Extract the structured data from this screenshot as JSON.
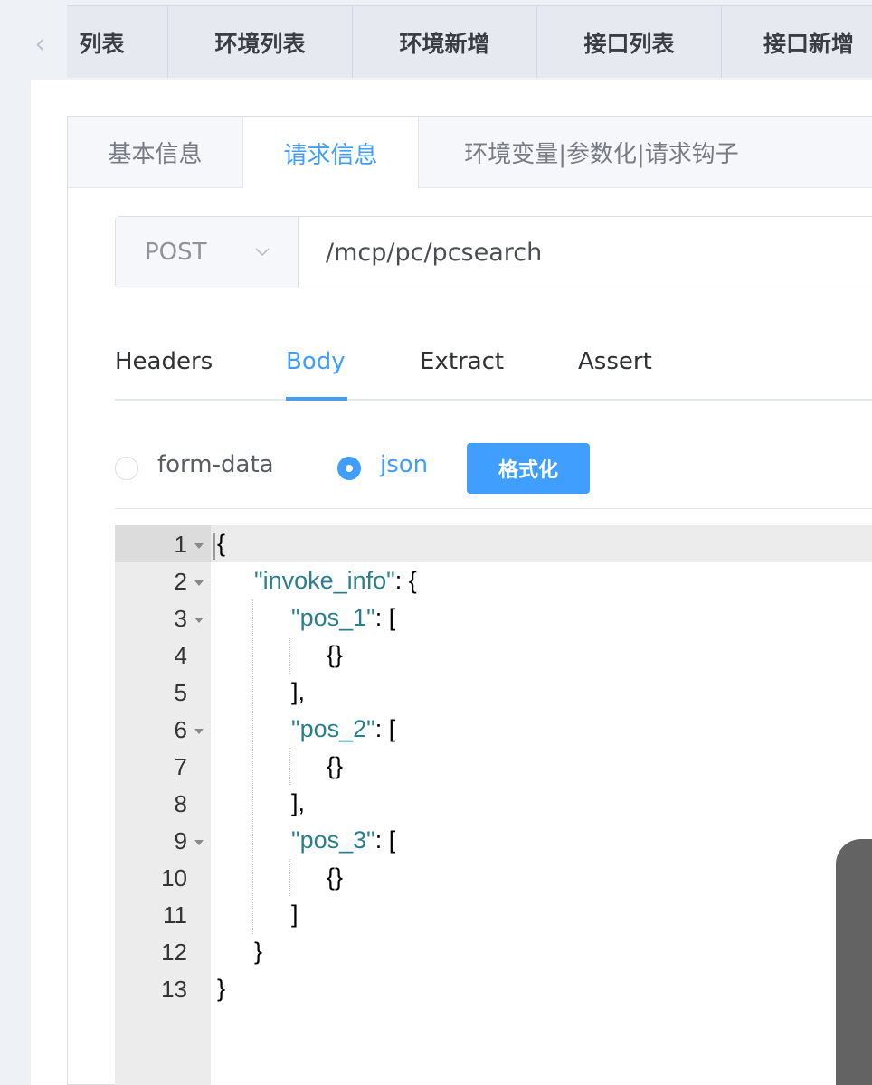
{
  "top_tabs": {
    "items": [
      {
        "label": "列表"
      },
      {
        "label": "环境列表"
      },
      {
        "label": "环境新增"
      },
      {
        "label": "接口列表"
      },
      {
        "label": "接口新增"
      }
    ]
  },
  "card_tabs": {
    "items": [
      {
        "label": "基本信息"
      },
      {
        "label": "请求信息"
      },
      {
        "label": "环境变量|参数化|请求钩子"
      }
    ]
  },
  "request": {
    "method": "POST",
    "url": "/mcp/pc/pcsearch"
  },
  "inner_tabs": {
    "items": [
      {
        "label": "Headers"
      },
      {
        "label": "Body"
      },
      {
        "label": "Extract"
      },
      {
        "label": "Assert"
      }
    ]
  },
  "body_type": {
    "form_data_label": "form-data",
    "json_label": "json",
    "selected": "json",
    "format_button": "格式化"
  },
  "editor": {
    "lines": [
      "1",
      "2",
      "3",
      "4",
      "5",
      "6",
      "7",
      "8",
      "9",
      "10",
      "11",
      "12",
      "13"
    ],
    "code": {
      "l1": "{",
      "l2_key": "\"invoke_info\"",
      "l2_rest": ": {",
      "l3_key": "\"pos_1\"",
      "l3_rest": ": [",
      "l4": "{}",
      "l5": "],",
      "l6_key": "\"pos_2\"",
      "l6_rest": ": [",
      "l7": "{}",
      "l8": "],",
      "l9_key": "\"pos_3\"",
      "l9_rest": ": [",
      "l10": "{}",
      "l11": "]",
      "l12": "}",
      "l13": "}"
    }
  },
  "colors": {
    "accent": "#409eff",
    "string": "#2a7f8f"
  }
}
